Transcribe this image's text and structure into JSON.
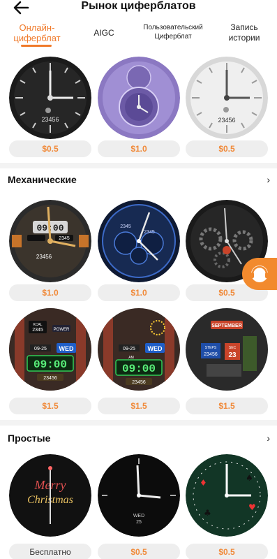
{
  "header": {
    "title": "Рынок циферблатов"
  },
  "tabs": [
    {
      "label_line1": "Онлайн-",
      "label_line2": "циферблат",
      "active": true
    },
    {
      "label": "AIGC"
    },
    {
      "label_line1": "Пользовательский",
      "label_line2": "Циферблат"
    },
    {
      "label_line1": "Запись",
      "label_line2": "истории"
    }
  ],
  "rows": [
    {
      "section": null,
      "items": [
        {
          "face": "black-silver-classic",
          "readout": "23456",
          "price": "$0.5"
        },
        {
          "face": "purple-layered",
          "readout": "",
          "price": "$1.0"
        },
        {
          "face": "white-silver",
          "readout": "23456",
          "price": "$0.5"
        }
      ]
    }
  ],
  "sections": [
    {
      "title": "Механические",
      "rows": [
        [
          {
            "face": "mechanical-gold",
            "digits": "09:00",
            "small1": "23456",
            "small2": "2345",
            "price": "$1.0"
          },
          {
            "face": "mechanical-blue",
            "small1": "2345",
            "small2": "2345",
            "price": "$1.0"
          },
          {
            "face": "mechanical-gears",
            "price": "$0.5"
          }
        ],
        [
          {
            "face": "steampunk-red",
            "kcal": "KCAL",
            "kcal_val": "2345",
            "power": "POWER",
            "date": "09-25",
            "day": "WED",
            "time": "09:00",
            "steps": "23456",
            "price": "$1.5"
          },
          {
            "face": "steampunk-red-2",
            "date": "09-25",
            "am": "AM",
            "day": "WED",
            "time": "09:00",
            "steps": "23456",
            "price": "$1.5"
          },
          {
            "face": "steampunk-tiles",
            "month": "SEPTEMBER",
            "steps": "STEPS",
            "steps_val": "23456",
            "sec": "SEC",
            "sec_val": "23",
            "price": "$1.5"
          }
        ]
      ]
    },
    {
      "title": "Простые",
      "rows": [
        [
          {
            "face": "merry-christmas",
            "text1": "Merry",
            "text2": "Christmas",
            "price": "Бесплатно"
          },
          {
            "face": "black-simple",
            "day": "WED",
            "date": "25",
            "price": "$0.5"
          },
          {
            "face": "green-cards",
            "price": "$0.5"
          }
        ]
      ]
    }
  ],
  "colors": {
    "accent": "#f07a2a",
    "price_text": "#f08a3a",
    "price_bg": "#eeeeee"
  },
  "icons": {
    "back": "arrow-left-icon",
    "chevron": "chevron-right-icon",
    "support": "headset-support-icon"
  }
}
